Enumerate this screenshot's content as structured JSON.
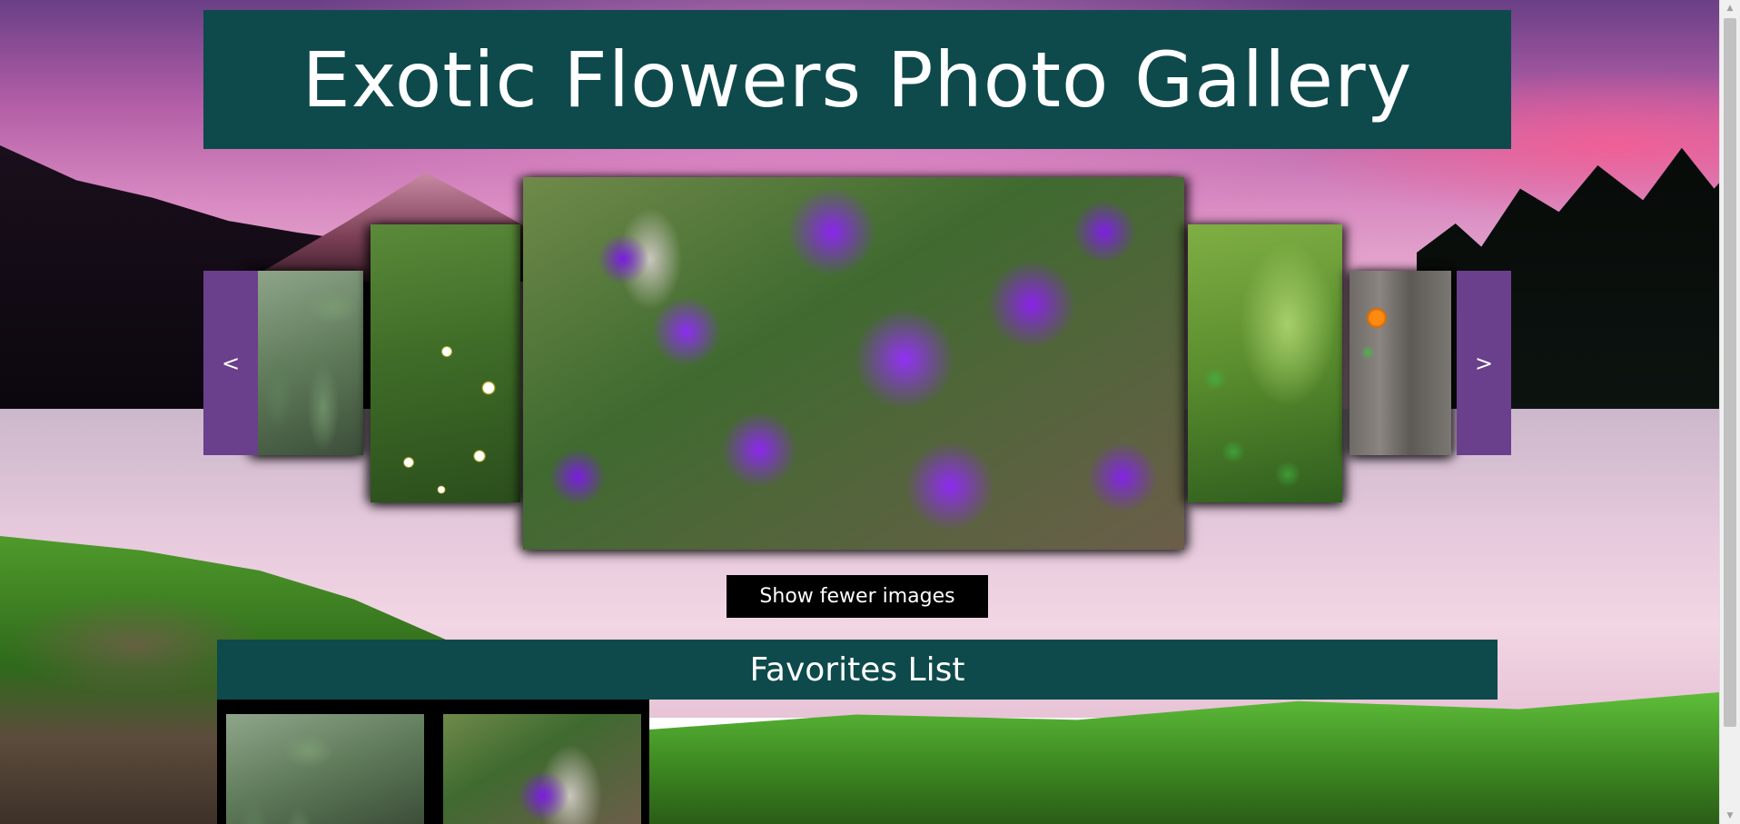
{
  "gallery": {
    "title": "Exotic Flowers Photo Gallery"
  },
  "carousel": {
    "prev_label": "<",
    "next_label": ">",
    "images": [
      {
        "subject": "cactus"
      },
      {
        "subject": "white daisies"
      },
      {
        "subject": "purple cineraria flowers"
      },
      {
        "subject": "clover and moss"
      },
      {
        "subject": "orange nasturtium"
      }
    ]
  },
  "controls": {
    "toggle_label": "Show fewer images"
  },
  "favorites": {
    "title": "Favorites List",
    "items": [
      {
        "subject": "cactus"
      },
      {
        "subject": "purple cineraria flowers"
      }
    ]
  }
}
